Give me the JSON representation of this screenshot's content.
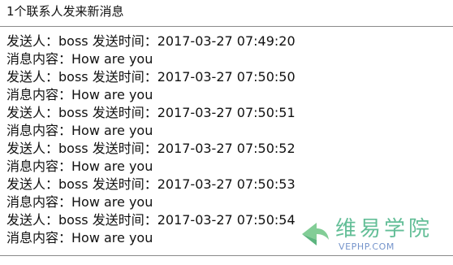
{
  "header": {
    "title": "1个联系人发来新消息"
  },
  "messages": [
    {
      "sender_line": "发送人：boss 发送时间：2017-03-27 07:49:20",
      "content_line": "消息内容：How are you"
    },
    {
      "sender_line": "发送人：boss 发送时间：2017-03-27 07:50:50",
      "content_line": "消息内容：How are you"
    },
    {
      "sender_line": "发送人：boss 发送时间：2017-03-27 07:50:51",
      "content_line": "消息内容：How are you"
    },
    {
      "sender_line": "发送人：boss 发送时间：2017-03-27 07:50:52",
      "content_line": "消息内容：How are you"
    },
    {
      "sender_line": "发送人：boss 发送时间：2017-03-27 07:50:53",
      "content_line": "消息内容：How are you"
    },
    {
      "sender_line": "发送人：boss 发送时间：2017-03-27 07:50:54",
      "content_line": "消息内容：How are you"
    }
  ],
  "watermark": {
    "title": "维易学院",
    "domain": "VEPHP.COM",
    "logo_icon": "arrow-icon",
    "colors": {
      "title": "#56b98f",
      "domain": "#6a8cc7"
    }
  }
}
